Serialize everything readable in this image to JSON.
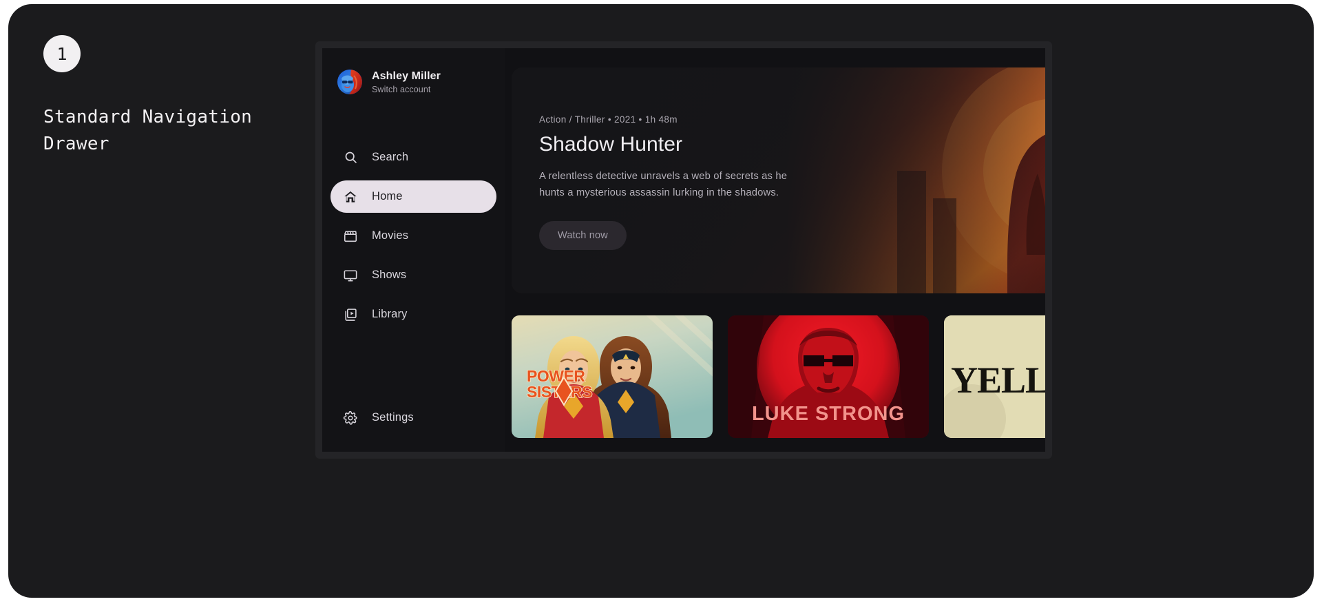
{
  "annotation": {
    "step_number": "1",
    "title": "Standard Navigation Drawer"
  },
  "colors": {
    "page_background": "#1B1B1D",
    "drawer_background": "#131316",
    "screen_background": "#111114",
    "active_item_background": "#E7E0E8",
    "active_item_text": "#1C1B1F",
    "text_primary": "#F1EFF2",
    "text_secondary": "#A7A3AC"
  },
  "drawer": {
    "account": {
      "name": "Ashley Miller",
      "subtitle": "Switch account",
      "avatar_icon": "user-avatar-portrait"
    },
    "items": [
      {
        "id": "search",
        "label": "Search",
        "icon": "search-icon",
        "active": false
      },
      {
        "id": "home",
        "label": "Home",
        "icon": "home-icon",
        "active": true
      },
      {
        "id": "movies",
        "label": "Movies",
        "icon": "clapperboard-icon",
        "active": false
      },
      {
        "id": "shows",
        "label": "Shows",
        "icon": "tv-icon",
        "active": false
      },
      {
        "id": "library",
        "label": "Library",
        "icon": "video-library-icon",
        "active": false
      }
    ],
    "footer_items": [
      {
        "id": "settings",
        "label": "Settings",
        "icon": "gear-icon",
        "active": false
      }
    ]
  },
  "hero": {
    "meta": "Action / Thriller • 2021 • 1h 48m",
    "title": "Shadow Hunter",
    "description": "A relentless detective unravels a web of secrets as he hunts a mysterious assassin lurking in the shadows.",
    "cta_label": "Watch now",
    "artwork": "muscular-hero-silhouette-orange-sunset"
  },
  "posters": [
    {
      "id": "power-sisters",
      "title": "POWER SISTERS",
      "art": "two-superheroines-pastel-sky"
    },
    {
      "id": "luke-strong",
      "title": "LUKE STRONG",
      "art": "man-sunglasses-red-circle"
    },
    {
      "id": "yellow",
      "title": "YELLOW",
      "art": "cream-background-serif-title"
    }
  ]
}
